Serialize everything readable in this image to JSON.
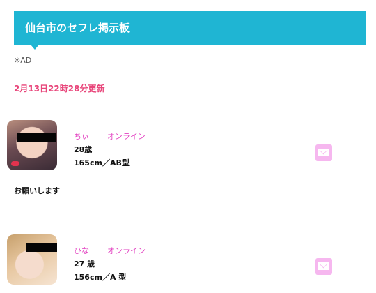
{
  "header": {
    "title": "仙台市のセフレ掲示板"
  },
  "ad_label": "※AD",
  "updated": "2月13日22時28分更新",
  "profiles": [
    {
      "name": "ちぃ",
      "status": "オンライン",
      "age": "28歳",
      "stats": "165cm／AB型",
      "comment": "お願いします"
    },
    {
      "name": "ひな",
      "status": "オンライン",
      "age": "27 歳",
      "stats": "156cm／A 型"
    }
  ],
  "colors": {
    "header": "#1fb5d3",
    "updated": "#e8457a",
    "name": "#e23fc0",
    "mail_button": "#f6b7ef"
  },
  "icons": {
    "mail": "mail-icon"
  }
}
